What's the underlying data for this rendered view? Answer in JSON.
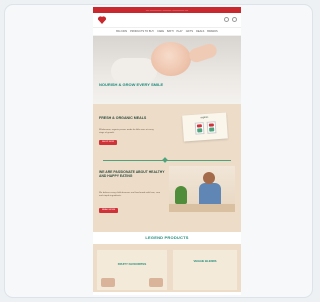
{
  "topbar": {
    "text": "— ———— ——— ———— —"
  },
  "header": {
    "nav_items": [
      "BIG KIDS",
      "PRODUCTS TO BUY",
      "CARE",
      "BATH",
      "PLAY",
      "GIFTS",
      "DEALS",
      "BRANDS"
    ]
  },
  "hero": {
    "title": "NOURISH & GROW EVERY SMILE"
  },
  "section1": {
    "title": "FRESH & ORGANIC MEALS",
    "text": "Wholesome, organic purees made for little ones at every stage of growth.",
    "button_label": "SHOP NOW",
    "board_title": "organic"
  },
  "section2": {
    "title": "WE ARE PASSIONATE ABOUT HEALTHY AND HAPPY EATING",
    "text": "We believe every child deserves real food made with love, care and simple ingredients.",
    "button_label": "READ MORE"
  },
  "legend": {
    "label": "LEGEND PRODUCTS"
  },
  "section3": {
    "card1_title": "FRUITY FAVOURITES",
    "card2_title": "VEGGIE BLENDS"
  },
  "colors": {
    "brand_red": "#c8282e",
    "accent_green": "#1f8a7a",
    "tan": "#ecdcc8"
  }
}
